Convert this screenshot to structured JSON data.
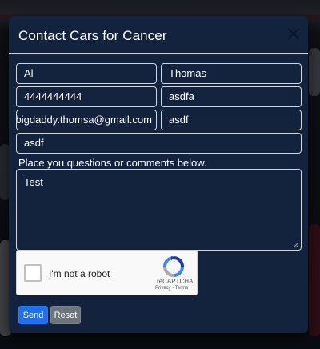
{
  "modal": {
    "title": "Contact Cars for Cancer"
  },
  "form": {
    "first_name": "Al",
    "last_name": "Thomas",
    "phone": "4444444444",
    "field_4": "asdfa",
    "email": "bigdaddy.thomsa@gmail.com",
    "field_6": "asdf",
    "field_7": "asdf",
    "help_text": "Place you questions or comments below.",
    "comments": "Test"
  },
  "captcha": {
    "label": "I'm not a robot",
    "brand": "reCAPTCHA",
    "links": "Privacy - Terms"
  },
  "buttons": {
    "send": "Send",
    "reset": "Reset"
  },
  "colors": {
    "modal_bg": "#14233d",
    "send": "#1f6ff3",
    "reset": "#6c757d"
  },
  "icons": [
    "close-icon",
    "recaptcha-logo-icon",
    "resize-grip-icon"
  ]
}
